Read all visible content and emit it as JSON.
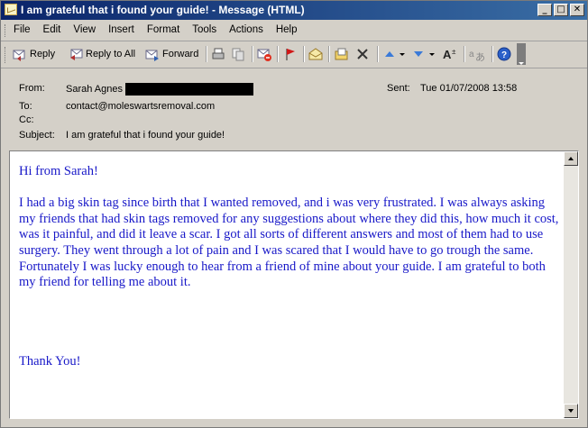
{
  "window": {
    "title": "I am grateful that i found your guide! - Message (HTML)",
    "minimize": "_",
    "maximize": "□",
    "close": "✕"
  },
  "menu": [
    "File",
    "Edit",
    "View",
    "Insert",
    "Format",
    "Tools",
    "Actions",
    "Help"
  ],
  "toolbar": {
    "reply": "Reply",
    "reply_all": "Reply to All",
    "forward": "Forward"
  },
  "header": {
    "from_label": "From:",
    "from_name": "Sarah Agnes",
    "sent_label": "Sent:",
    "sent_value": "Tue 01/07/2008 13:58",
    "to_label": "To:",
    "to_value": "contact@moleswartsremoval.com",
    "cc_label": "Cc:",
    "cc_value": "",
    "subject_label": "Subject:",
    "subject_value": "I am grateful that i found your guide!"
  },
  "message": {
    "greeting": "Hi from Sarah!",
    "paragraph": "I had a big skin tag since birth that I wanted removed, and i was very frustrated. I was always asking my friends that had skin tags removed for any suggestions about where they did this, how much it cost, was it painful, and did it leave a scar. I got all sorts of different answers and most of them had to use surgery. They went through a lot of pain and I was scared that I would have to go trough the same. Fortunately I was lucky enough to hear from a friend of mine about your guide. I am grateful to both my friend for telling me about it.",
    "closing": "Thank You!"
  },
  "colors": {
    "title_bar_start": "#0a246a",
    "title_bar_end": "#3a6ea5",
    "message_text": "#1818c8",
    "chrome": "#d4d0c8"
  }
}
